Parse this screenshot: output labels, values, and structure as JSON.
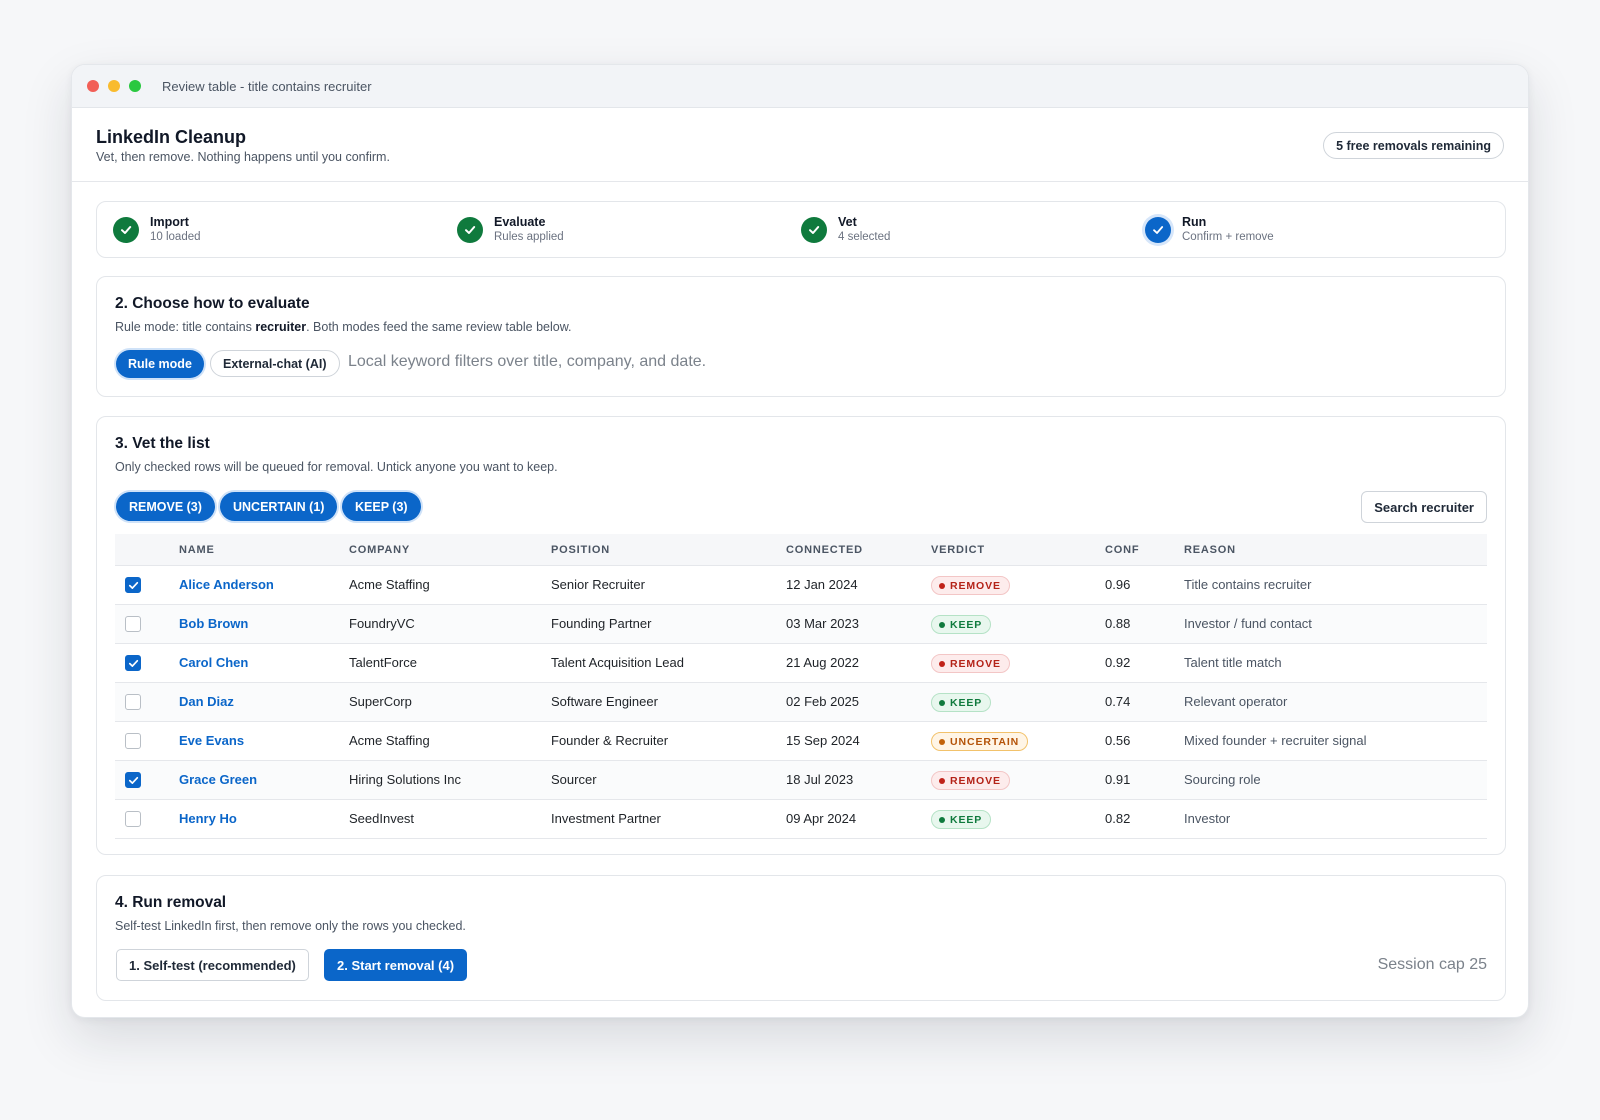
{
  "window": {
    "title": "Review table - title contains recruiter"
  },
  "header": {
    "title": "LinkedIn Cleanup",
    "subtitle": "Vet, then remove. Nothing happens until you confirm.",
    "remaining_badge": "5 free removals remaining"
  },
  "steps": [
    {
      "label": "Import",
      "desc": "10 loaded",
      "state": "done"
    },
    {
      "label": "Evaluate",
      "desc": "Rules applied",
      "state": "done"
    },
    {
      "label": "Vet",
      "desc": "4 selected",
      "state": "done"
    },
    {
      "label": "Run",
      "desc": "Confirm + remove",
      "state": "active"
    }
  ],
  "evaluate": {
    "title": "2. Choose how to evaluate",
    "desc_prefix": "Rule mode: title contains ",
    "desc_keyword": "recruiter",
    "desc_suffix": ". Both modes feed the same review table below.",
    "rule_mode_label": "Rule mode",
    "external_chat_label": "External-chat (AI)",
    "mode_hint": "Local keyword filters over title, company, and date."
  },
  "vet": {
    "title": "3. Vet the list",
    "desc": "Only checked rows will be queued for removal. Untick anyone you want to keep.",
    "filters": [
      {
        "label": "REMOVE (3)"
      },
      {
        "label": "UNCERTAIN (1)"
      },
      {
        "label": "KEEP (3)"
      }
    ],
    "search_label": "Search recruiter",
    "columns": {
      "name": "NAME",
      "company": "COMPANY",
      "position": "POSITION",
      "connected": "CONNECTED",
      "verdict": "VERDICT",
      "conf": "CONF",
      "reason": "REASON"
    },
    "rows": [
      {
        "checked": true,
        "name": "Alice Anderson",
        "company": "Acme Staffing",
        "position": "Senior Recruiter",
        "connected": "12 Jan 2024",
        "verdict": "REMOVE",
        "verdict_kind": "remove",
        "conf": "0.96",
        "reason": "Title contains recruiter"
      },
      {
        "checked": false,
        "name": "Bob Brown",
        "company": "FoundryVC",
        "position": "Founding Partner",
        "connected": "03 Mar 2023",
        "verdict": "KEEP",
        "verdict_kind": "keep",
        "conf": "0.88",
        "reason": "Investor / fund contact"
      },
      {
        "checked": true,
        "name": "Carol Chen",
        "company": "TalentForce",
        "position": "Talent Acquisition Lead",
        "connected": "21 Aug 2022",
        "verdict": "REMOVE",
        "verdict_kind": "remove",
        "conf": "0.92",
        "reason": "Talent title match"
      },
      {
        "checked": false,
        "name": "Dan Diaz",
        "company": "SuperCorp",
        "position": "Software Engineer",
        "connected": "02 Feb 2025",
        "verdict": "KEEP",
        "verdict_kind": "keep",
        "conf": "0.74",
        "reason": "Relevant operator"
      },
      {
        "checked": false,
        "name": "Eve Evans",
        "company": "Acme Staffing",
        "position": "Founder & Recruiter",
        "connected": "15 Sep 2024",
        "verdict": "UNCERTAIN",
        "verdict_kind": "uncertain",
        "conf": "0.56",
        "reason": "Mixed founder + recruiter signal"
      },
      {
        "checked": true,
        "name": "Grace Green",
        "company": "Hiring Solutions Inc",
        "position": "Sourcer",
        "connected": "18 Jul 2023",
        "verdict": "REMOVE",
        "verdict_kind": "remove",
        "conf": "0.91",
        "reason": "Sourcing role"
      },
      {
        "checked": false,
        "name": "Henry Ho",
        "company": "SeedInvest",
        "position": "Investment Partner",
        "connected": "09 Apr 2024",
        "verdict": "KEEP",
        "verdict_kind": "keep",
        "conf": "0.82",
        "reason": "Investor"
      }
    ]
  },
  "run": {
    "title": "4. Run removal",
    "desc": "Self-test LinkedIn first, then remove only the rows you checked.",
    "self_test_label": "1. Self-test (recommended)",
    "start_label": "2. Start removal (4)",
    "session_cap": "Session cap 25"
  },
  "colors": {
    "accent": "#0b66c9",
    "success": "#0f7a3d",
    "danger": "#b42318",
    "warning": "#b45309"
  }
}
